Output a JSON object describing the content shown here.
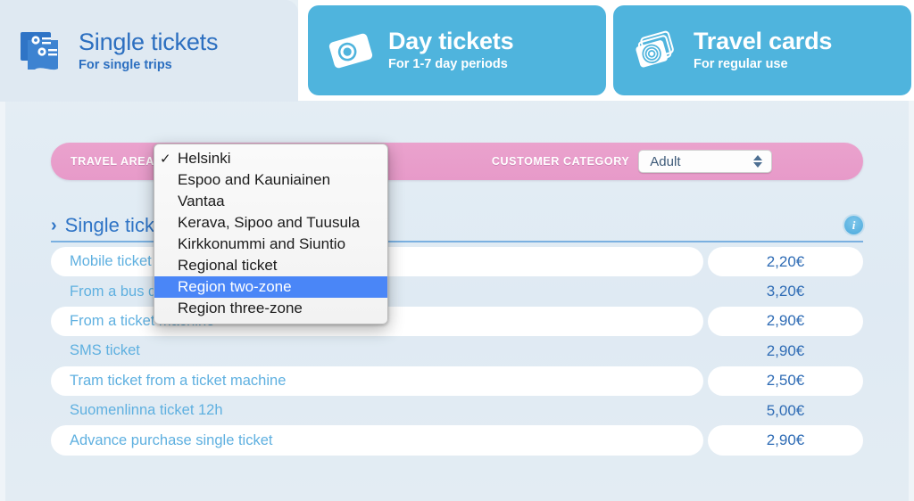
{
  "tabs": [
    {
      "id": "single",
      "title": "Single tickets",
      "subtitle": "For single trips",
      "icon": "two-tickets-icon",
      "active": true
    },
    {
      "id": "day",
      "title": "Day tickets",
      "subtitle": "For 1-7 day periods",
      "icon": "single-card-icon",
      "active": false
    },
    {
      "id": "travel",
      "title": "Travel cards",
      "subtitle": "For regular use",
      "icon": "stacked-cards-icon",
      "active": false
    }
  ],
  "filters": {
    "travel_area_label": "TRAVEL AREA",
    "travel_area_value": "Helsinki",
    "customer_category_label": "CUSTOMER CATEGORY",
    "customer_category_value": "Adult"
  },
  "dropdown": {
    "open": true,
    "checked": "Helsinki",
    "highlighted": "Region two-zone",
    "options": [
      "Helsinki",
      "Espoo and Kauniainen",
      "Vantaa",
      "Kerava, Sipoo and Tuusula",
      "Kirkkonummi and Siuntio",
      "Regional ticket",
      "Region two-zone",
      "Region three-zone"
    ]
  },
  "section": {
    "chevron": "›",
    "title": "Single tickets",
    "info_icon": "info-icon",
    "info_glyph": "i"
  },
  "tickets": [
    {
      "name": "Mobile ticket",
      "price": "2,20€"
    },
    {
      "name": "From a bus driver",
      "price": "3,20€"
    },
    {
      "name": "From a ticket machine",
      "price": "2,90€"
    },
    {
      "name": "SMS ticket",
      "price": "2,90€"
    },
    {
      "name": "Tram ticket from a ticket machine",
      "price": "2,50€"
    },
    {
      "name": "Suomenlinna ticket 12h",
      "price": "5,00€"
    },
    {
      "name": "Advance purchase single ticket",
      "price": "2,90€"
    }
  ],
  "colors": {
    "page_bg": "#e3ecf3",
    "tab_blue": "#4fb4dd",
    "tab_active_bg": "#dfe9f2",
    "pink_bar": "#e79ac9",
    "link_blue": "#5fb0e0",
    "price_blue": "#2f6cb5",
    "highlight_blue": "#4a86f7"
  }
}
